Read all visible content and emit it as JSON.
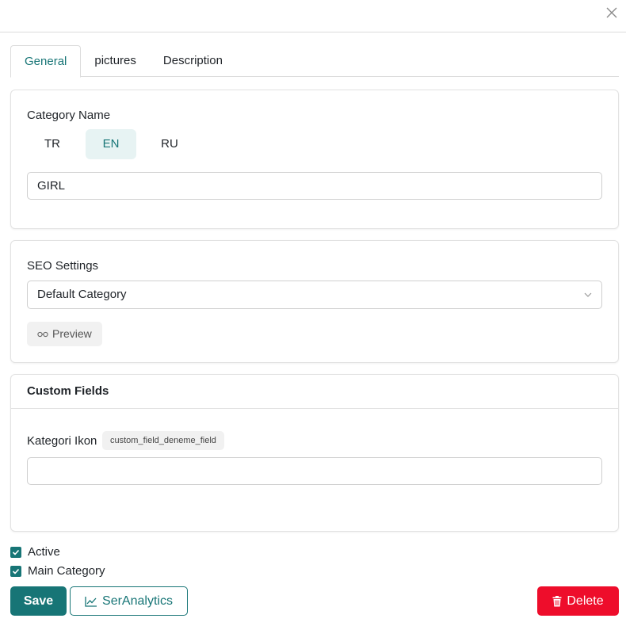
{
  "tabs": [
    {
      "label": "General",
      "active": true
    },
    {
      "label": "pictures",
      "active": false
    },
    {
      "label": "Description",
      "active": false
    }
  ],
  "category_name": {
    "label": "Category Name",
    "languages": [
      {
        "code": "TR",
        "active": false
      },
      {
        "code": "EN",
        "active": true
      },
      {
        "code": "RU",
        "active": false
      }
    ],
    "value": "GIRL"
  },
  "seo": {
    "label": "SEO Settings",
    "selected": "Default Category",
    "preview_label": "Preview"
  },
  "custom_fields": {
    "header": "Custom Fields",
    "field_label": "Kategori Ikon",
    "field_key": "custom_field_deneme_field",
    "field_value": ""
  },
  "checkboxes": [
    {
      "label": "Active",
      "checked": true
    },
    {
      "label": "Main Category",
      "checked": true
    }
  ],
  "actions": {
    "save_label": "Save",
    "analytics_label": "SerAnalytics",
    "delete_label": "Delete"
  },
  "colors": {
    "primary": "#177576",
    "primary_light": "#e7f3f3",
    "danger": "#ee0d2b"
  },
  "icons": {
    "close": "close-icon",
    "chevron": "chevron-down-icon",
    "preview": "glasses-icon",
    "analytics": "chart-line-icon",
    "delete": "trash-icon",
    "check": "checkmark-icon"
  }
}
